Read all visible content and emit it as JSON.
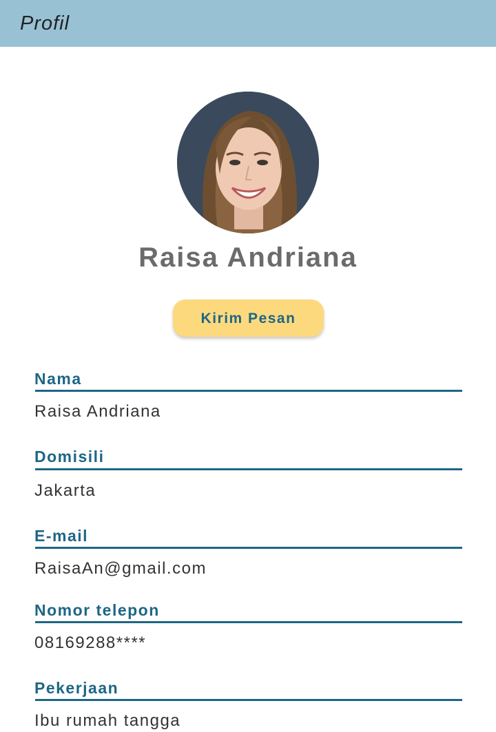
{
  "header": {
    "title": "Profil"
  },
  "profile": {
    "name": "Raisa Andriana",
    "send_message_label": "Kirim Pesan"
  },
  "fields": [
    {
      "label": "Nama",
      "value": "Raisa Andriana"
    },
    {
      "label": "Domisili",
      "value": "Jakarta"
    },
    {
      "label": "E-mail",
      "value": "RaisaAn@gmail.com"
    },
    {
      "label": "Nomor telepon",
      "value": "08169288****"
    },
    {
      "label": "Pekerjaan",
      "value": "Ibu rumah tangga"
    }
  ],
  "colors": {
    "header_bg": "#99c1d4",
    "accent": "#1d6685",
    "button_bg": "#fdd97d",
    "name_text": "#6b6b6b"
  }
}
